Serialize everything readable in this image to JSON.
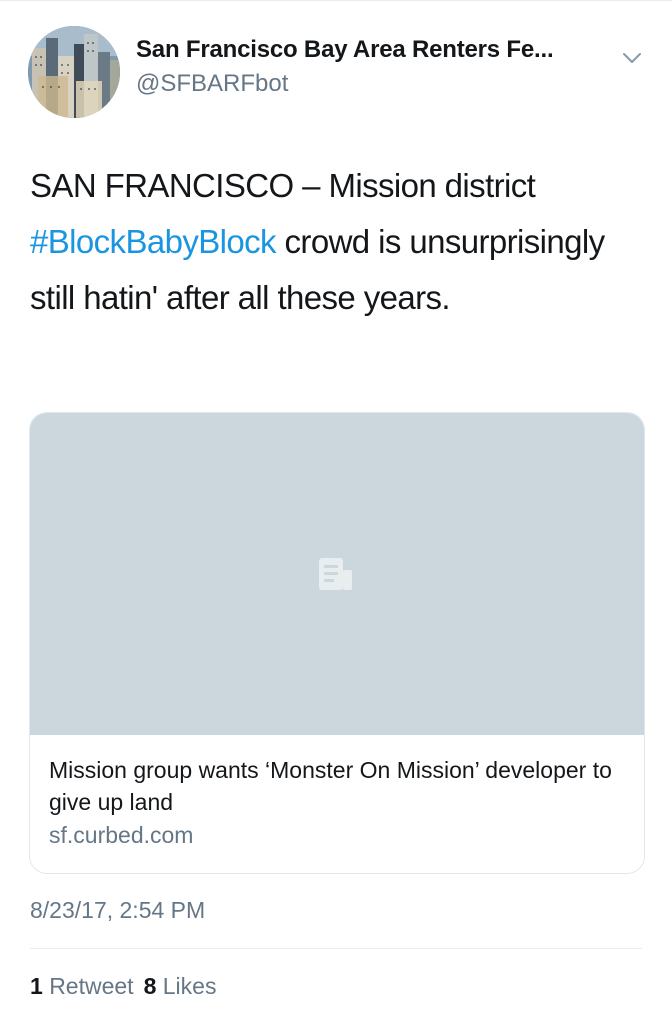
{
  "author": {
    "display_name": "San Francisco Bay Area Renters Fe...",
    "handle": "@SFBARFbot"
  },
  "icons": {
    "menu": "chevron-down-icon",
    "card_placeholder": "document-icon"
  },
  "tweet": {
    "text_part1": "SAN FRANCISCO – Mission district ",
    "hashtag": "#BlockBabyBlock",
    "text_part2": " crowd is unsurprisingly still hatin' after all these years."
  },
  "card": {
    "title": "Mission group wants ‘Monster On Mission’ developer to give up land",
    "domain": "sf.curbed.com"
  },
  "timestamp": "8/23/17, 2:54 PM",
  "stats": {
    "retweets_count": "1",
    "retweets_label": "Retweet",
    "likes_count": "8",
    "likes_label": "Likes"
  },
  "colors": {
    "link": "#1b95e0",
    "secondary_text": "#657786",
    "card_placeholder_bg": "#ccd6dd"
  }
}
